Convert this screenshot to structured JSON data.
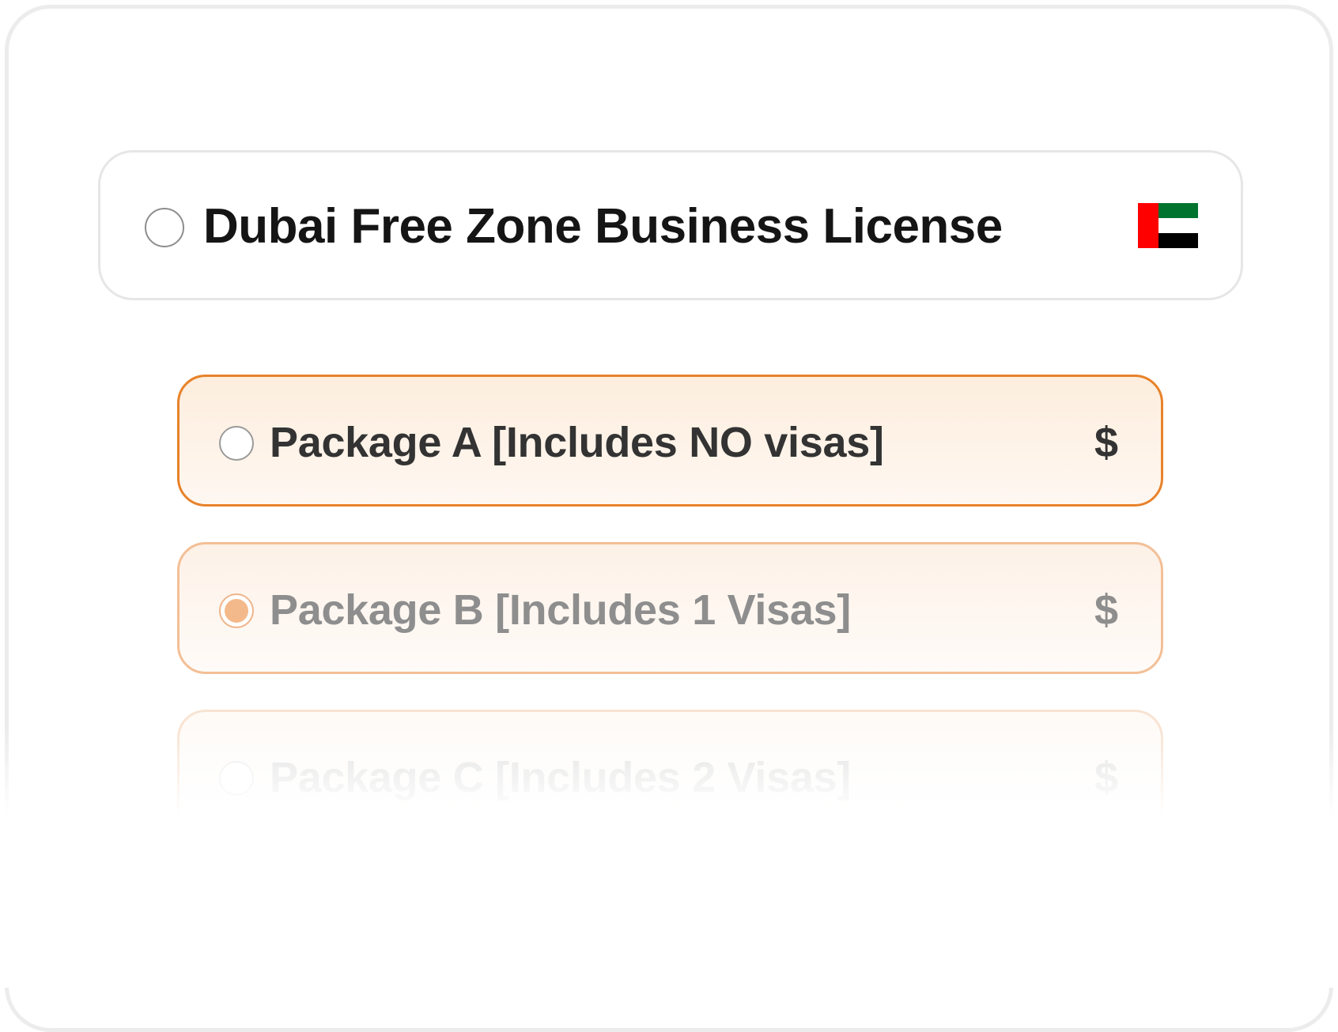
{
  "license": {
    "title": "Dubai Free Zone Business License",
    "flag_icon": "uae-flag-icon",
    "flag_colors": {
      "red": "#ff0000",
      "green": "#00732f",
      "white": "#ffffff",
      "black": "#000000"
    }
  },
  "packages": [
    {
      "label": "Package A [Includes NO visas]",
      "price": "$",
      "selected": false
    },
    {
      "label": "Package B [Includes 1 Visas]",
      "price": "$",
      "selected": true
    },
    {
      "label": "Package C [Includes 2 Visas]",
      "price": "$",
      "selected": false
    }
  ],
  "colors": {
    "accent": "#e8822a",
    "accent_light": "#f4b98a"
  }
}
